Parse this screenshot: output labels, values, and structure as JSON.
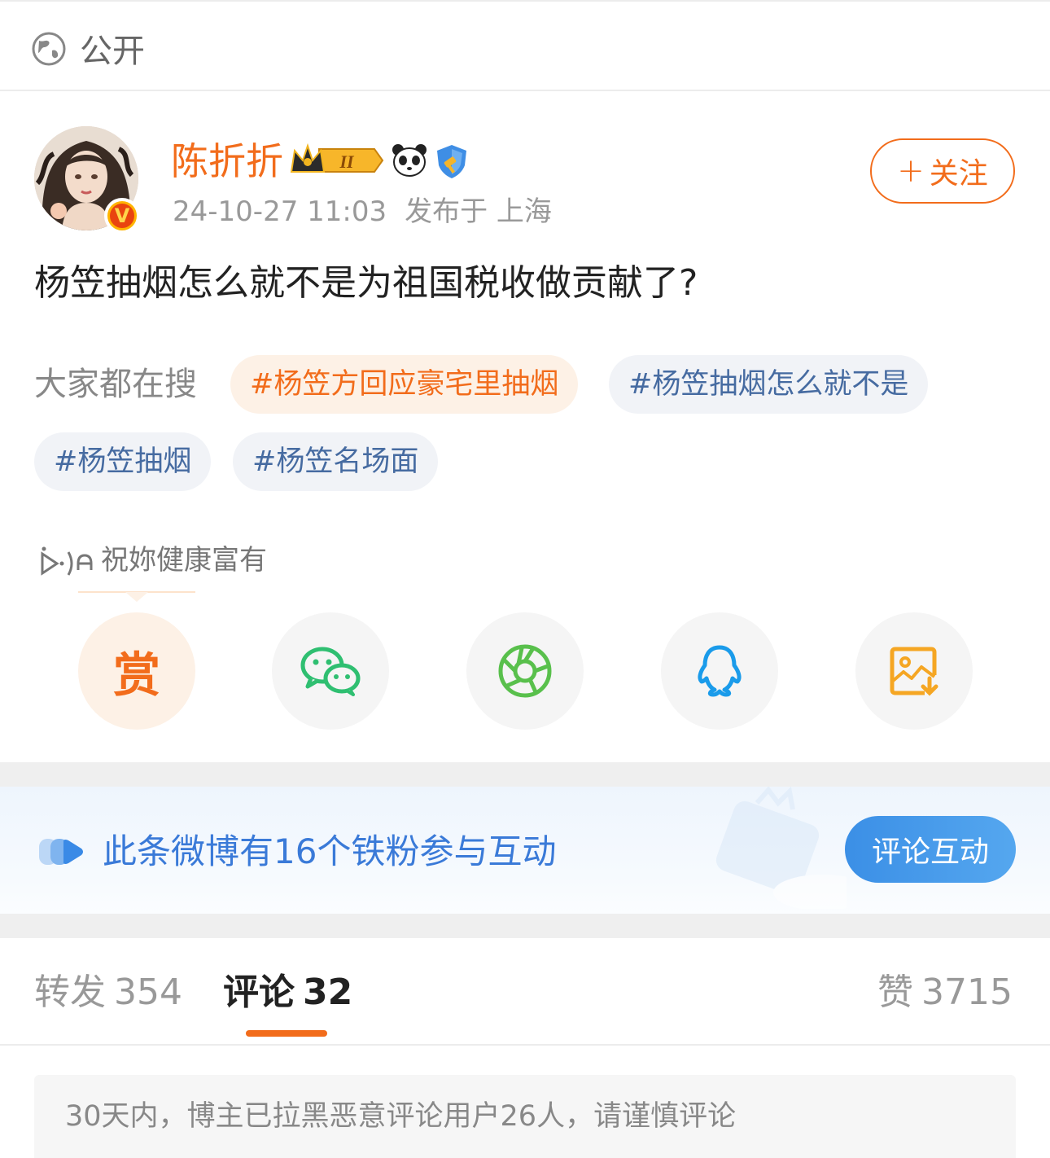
{
  "visibility": {
    "label": "公开",
    "icon": "globe-icon"
  },
  "author": {
    "name": "陈折折",
    "verified_badge": "V",
    "badges": [
      "crown-level-badge",
      "panda-icon",
      "shield-icon"
    ],
    "crown_level": "II"
  },
  "post": {
    "timestamp": "24-10-27 11:03",
    "location": "发布于 上海",
    "text": "杨笠抽烟怎么就不是为祖国税收做贡献了?"
  },
  "follow_button": {
    "plus": "+",
    "label": "关注"
  },
  "search_tags": {
    "label": "大家都在搜",
    "tags": [
      "#杨笠方回应豪宅里抽烟",
      "#杨笠抽烟怎么就不是",
      "#杨笠抽烟",
      "#杨笠名场面"
    ]
  },
  "wish": {
    "text": "祝妳健康富有"
  },
  "share": {
    "reward_label": "赏",
    "items": [
      "reward-icon",
      "wechat-icon",
      "moments-icon",
      "qq-icon",
      "save-image-icon"
    ]
  },
  "fans_banner": {
    "text": "此条微博有16个铁粉参与互动",
    "button": "评论互动"
  },
  "tabs": {
    "repost": {
      "label": "转发",
      "count": "354"
    },
    "comment": {
      "label": "评论",
      "count": "32"
    },
    "like": {
      "label": "赞",
      "count": "3715"
    }
  },
  "notice": {
    "text": "30天内，博主已拉黑恶意评论用户26人，请谨慎评论"
  },
  "colors": {
    "accent": "#f26c1b",
    "link": "#466ba1",
    "banner_blue": "#3a7ad8"
  }
}
